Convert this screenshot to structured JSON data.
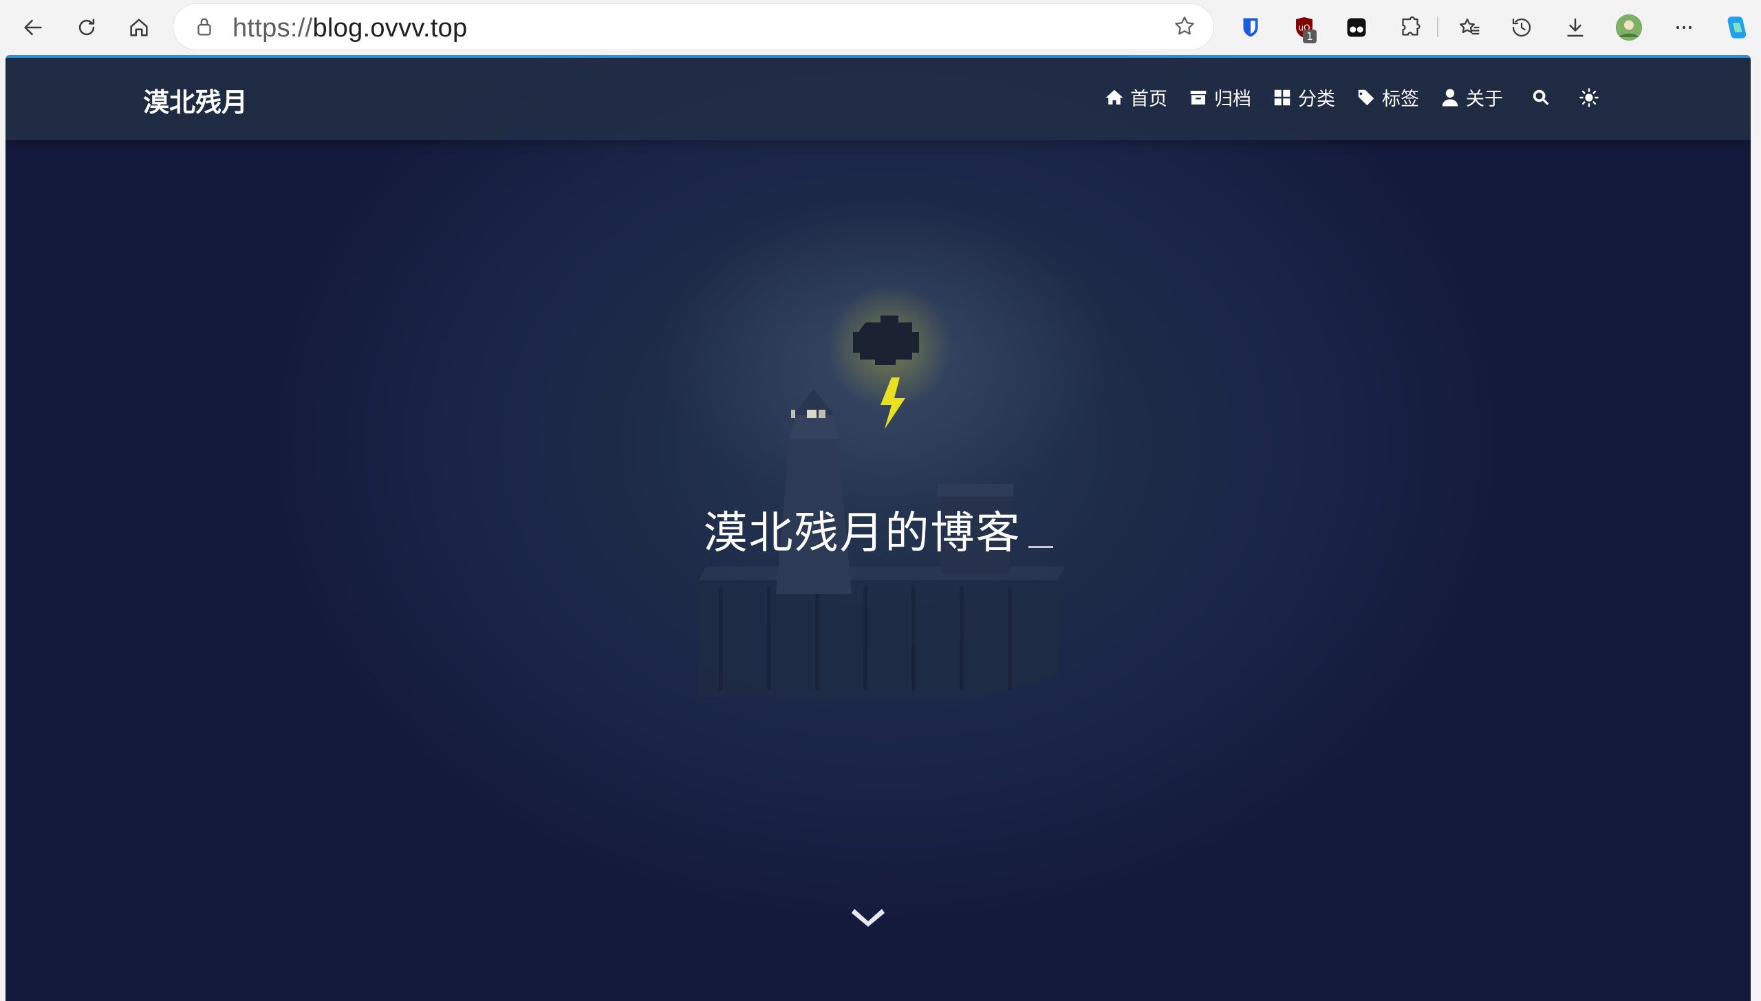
{
  "browser": {
    "url_protocol": "https://",
    "url_host": "blog.ovvv.top",
    "extension_badge": "1"
  },
  "site": {
    "logo": "漠北残月",
    "nav": [
      {
        "label": "首页",
        "icon": "home-icon"
      },
      {
        "label": "归档",
        "icon": "archive-icon"
      },
      {
        "label": "分类",
        "icon": "category-icon"
      },
      {
        "label": "标签",
        "icon": "tags-icon"
      },
      {
        "label": "关于",
        "icon": "user-icon"
      }
    ],
    "search_icon": "search-icon",
    "theme_icon": "sun-icon"
  },
  "hero": {
    "title": "漠北残月的博客"
  },
  "colors": {
    "header_bg": "#243046",
    "page_bg": "#1a2447",
    "accent_line": "#2f8fd8",
    "bolt": "#e8e020"
  }
}
